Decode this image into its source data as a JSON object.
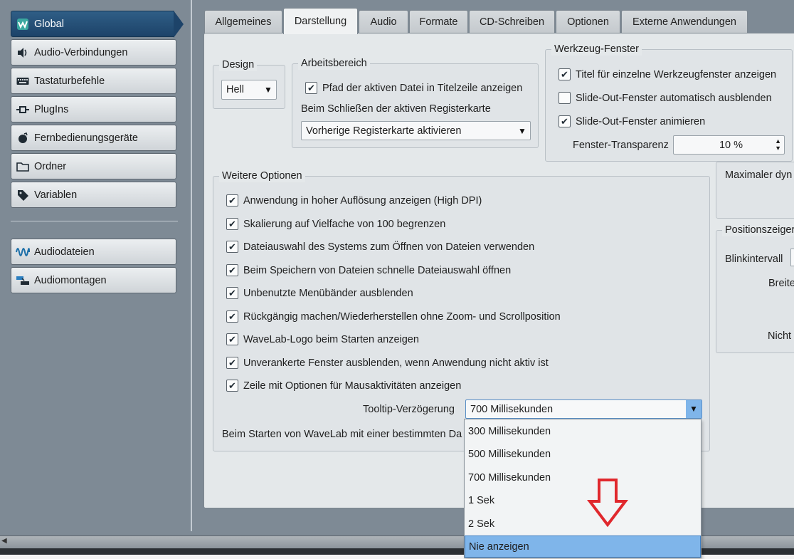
{
  "sidebar": {
    "items": [
      {
        "label": "Global",
        "icon": "wavelab-icon"
      },
      {
        "label": "Audio-Verbindungen",
        "icon": "speaker-icon"
      },
      {
        "label": "Tastaturbefehle",
        "icon": "keyboard-icon"
      },
      {
        "label": "PlugIns",
        "icon": "plugin-icon"
      },
      {
        "label": "Fernbedienungsgeräte",
        "icon": "remote-icon"
      },
      {
        "label": "Ordner",
        "icon": "folder-icon"
      },
      {
        "label": "Variablen",
        "icon": "tag-icon"
      }
    ],
    "items2": [
      {
        "label": "Audiodateien",
        "icon": "waveform-icon"
      },
      {
        "label": "Audiomontagen",
        "icon": "montage-icon"
      }
    ]
  },
  "tabs": [
    "Allgemeines",
    "Darstellung",
    "Audio",
    "Formate",
    "CD-Schreiben",
    "Optionen",
    "Externe Anwendungen"
  ],
  "active_tab": "Darstellung",
  "design": {
    "title": "Design",
    "value": "Hell"
  },
  "arbeitsbereich": {
    "title": "Arbeitsbereich",
    "pfad_label": "Pfad der aktiven Datei in Titelzeile anzeigen",
    "pfad_checked": true,
    "schliessen_label": "Beim Schließen der aktiven Registerkarte",
    "schliessen_value": "Vorherige Registerkarte aktivieren"
  },
  "werkzeug": {
    "title": "Werkzeug-Fenster",
    "options": [
      {
        "label": "Titel für einzelne Werkzeugfenster anzeigen",
        "checked": true
      },
      {
        "label": "Slide-Out-Fenster automatisch ausblenden",
        "checked": false
      },
      {
        "label": "Slide-Out-Fenster animieren",
        "checked": true
      }
    ],
    "transparenz_label": "Fenster-Transparenz",
    "transparenz_value": "10 %"
  },
  "weitere": {
    "title": "Weitere Optionen",
    "options": [
      {
        "label": "Anwendung in hoher Auflösung anzeigen (High DPI)",
        "checked": true
      },
      {
        "label": "Skalierung auf Vielfache von 100 begrenzen",
        "checked": true
      },
      {
        "label": "Dateiauswahl des Systems zum Öffnen von Dateien verwenden",
        "checked": true
      },
      {
        "label": "Beim Speichern von Dateien schnelle Dateiauswahl öffnen",
        "checked": true
      },
      {
        "label": "Unbenutzte Menübänder ausblenden",
        "checked": true
      },
      {
        "label": "Rückgängig machen/Wiederherstellen ohne Zoom- und Scrollposition",
        "checked": true
      },
      {
        "label": "WaveLab-Logo beim Starten anzeigen",
        "checked": true
      },
      {
        "label": "Unverankerte Fenster ausblenden, wenn Anwendung nicht aktiv ist",
        "checked": true
      },
      {
        "label": "Zeile mit Optionen für Mausaktivitäten anzeigen",
        "checked": true
      }
    ],
    "tooltip_label": "Tooltip-Verzögerung",
    "tooltip_value": "700 Millisekunden",
    "starten_label": "Beim Starten von WaveLab mit einer bestimmten Da"
  },
  "right_partial": {
    "maximaler": "Maximaler dyn",
    "positionszeiger": "Positionszeiger",
    "blinkintervall": "Blinkintervall",
    "breite": "Breite",
    "nicht": "Nicht"
  },
  "dropdown": {
    "options": [
      "300 Millisekunden",
      "500 Millisekunden",
      "700 Millisekunden",
      "1 Sek",
      "2 Sek",
      "Nie anzeigen"
    ],
    "highlighted": "Nie anzeigen"
  },
  "colors": {
    "accent": "#1d4369",
    "highlight": "#7fb5ea",
    "annotation_arrow": "#e0282d"
  }
}
